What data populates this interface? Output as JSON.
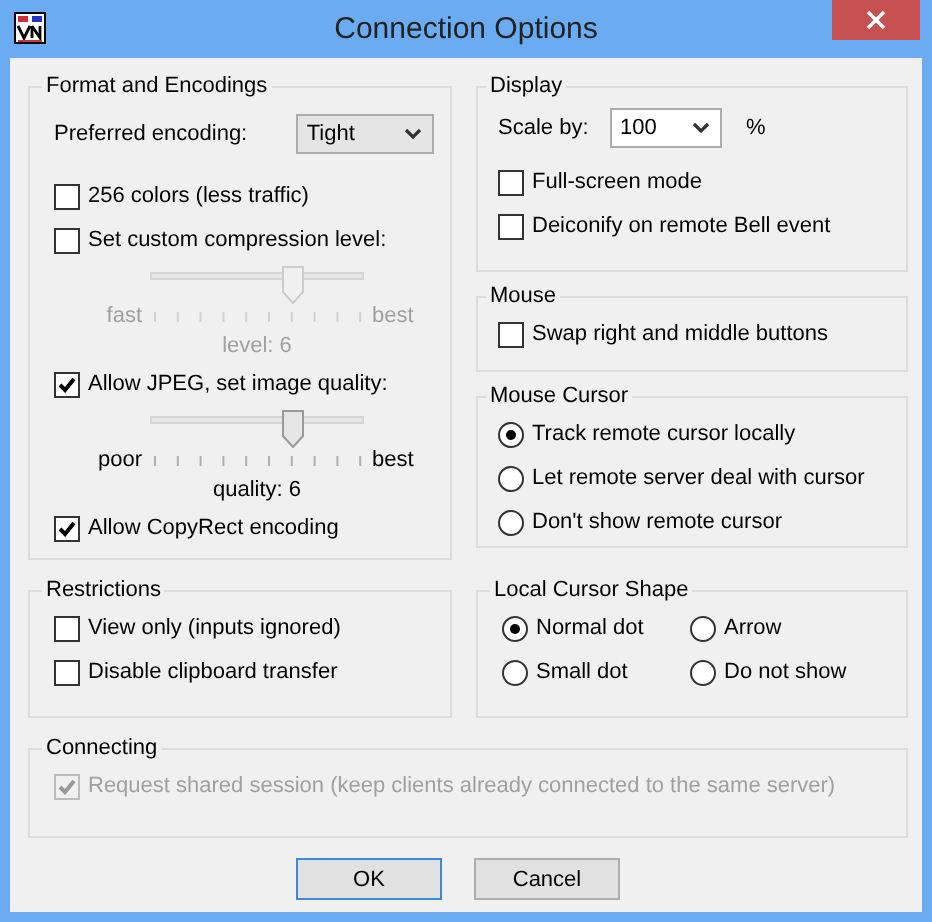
{
  "window": {
    "title": "Connection Options"
  },
  "format_and_encodings": {
    "title": "Format and Encodings",
    "preferred_encoding": {
      "label": "Preferred encoding:",
      "value": "Tight"
    },
    "options": [
      {
        "kind": "checkbox",
        "label": "256 colors (less traffic)",
        "checked": false
      },
      {
        "kind": "checkbox",
        "label": "Set custom compression level:",
        "checked": false
      },
      {
        "kind": "slider",
        "min_label": "fast",
        "max_label": "best",
        "reading": "level: 6",
        "level": 0.667,
        "disabled": true
      },
      {
        "kind": "checkbox",
        "label": "Allow JPEG, set image quality:",
        "checked": true
      },
      {
        "kind": "slider",
        "min_label": "poor",
        "max_label": "best",
        "reading": "quality: 6",
        "level": 0.667,
        "disabled": false
      },
      {
        "kind": "checkbox",
        "label": "Allow CopyRect encoding",
        "checked": true
      }
    ]
  },
  "display": {
    "title": "Display",
    "scale": {
      "label": "Scale by:",
      "value": "100",
      "unit": "%"
    },
    "options": [
      {
        "label": "Full-screen mode",
        "checked": false
      },
      {
        "label": "Deiconify on remote Bell event",
        "checked": false
      }
    ]
  },
  "mouse": {
    "title": "Mouse",
    "options": [
      {
        "label": "Swap right and middle buttons",
        "checked": false
      }
    ]
  },
  "mouse_cursor": {
    "title": "Mouse Cursor",
    "options": [
      {
        "label": "Track remote cursor locally",
        "selected": true
      },
      {
        "label": "Let remote server deal with cursor",
        "selected": false
      },
      {
        "label": "Don't show remote cursor",
        "selected": false
      }
    ]
  },
  "restrictions": {
    "title": "Restrictions",
    "options": [
      {
        "label": "View only (inputs ignored)",
        "checked": false
      },
      {
        "label": "Disable clipboard transfer",
        "checked": false
      }
    ]
  },
  "local_cursor_shape": {
    "title": "Local Cursor Shape",
    "options": [
      {
        "label": "Normal dot",
        "selected": true
      },
      {
        "label": "Arrow",
        "selected": false
      },
      {
        "label": "Small dot",
        "selected": false
      },
      {
        "label": "Do not show",
        "selected": false
      }
    ]
  },
  "connecting": {
    "title": "Connecting",
    "options": [
      {
        "label": "Request shared session (keep clients already connected to the same server)",
        "checked": true,
        "disabled": true
      }
    ]
  },
  "buttons": [
    {
      "label": "OK",
      "default": true
    },
    {
      "label": "Cancel",
      "default": false
    }
  ]
}
